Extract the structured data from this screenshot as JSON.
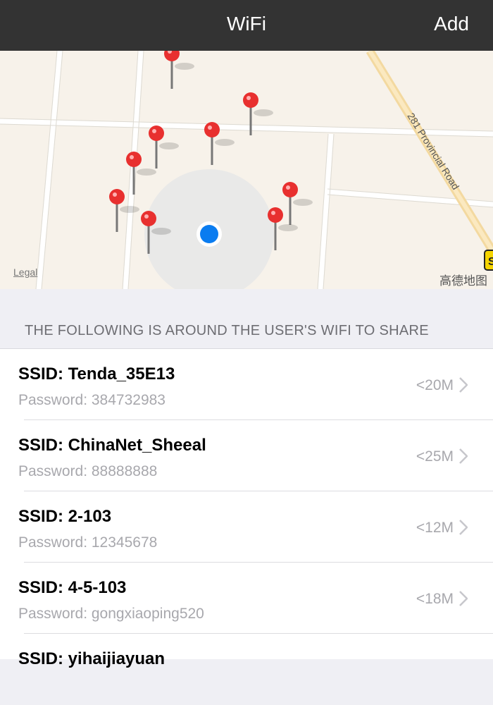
{
  "navbar": {
    "title": "WiFi",
    "add_label": "Add"
  },
  "map": {
    "road_label": "281 Provincial Road",
    "legal_label": "Legal",
    "provider_label": "高德地图",
    "sign_label": "S",
    "pin_count": 10
  },
  "section": {
    "header": "THE FOLLOWING IS AROUND THE USER'S WIFI TO SHARE"
  },
  "networks": [
    {
      "ssid": "SSID: Tenda_35E13",
      "password": "Password: 384732983",
      "distance": "<20M"
    },
    {
      "ssid": "SSID: ChinaNet_Sheeal",
      "password": "Password: 88888888",
      "distance": "<25M"
    },
    {
      "ssid": "SSID: 2-103",
      "password": "Password: 12345678",
      "distance": "<12M"
    },
    {
      "ssid": "SSID: 4-5-103",
      "password": "Password: gongxiaoping520",
      "distance": "<18M"
    },
    {
      "ssid": "SSID: yihaijiayuan",
      "password": "",
      "distance": ""
    }
  ],
  "colors": {
    "navbar": "#333333",
    "pin": "#e8302f",
    "user_dot": "#0a7cf0",
    "map_bg": "#f7f2ea"
  }
}
